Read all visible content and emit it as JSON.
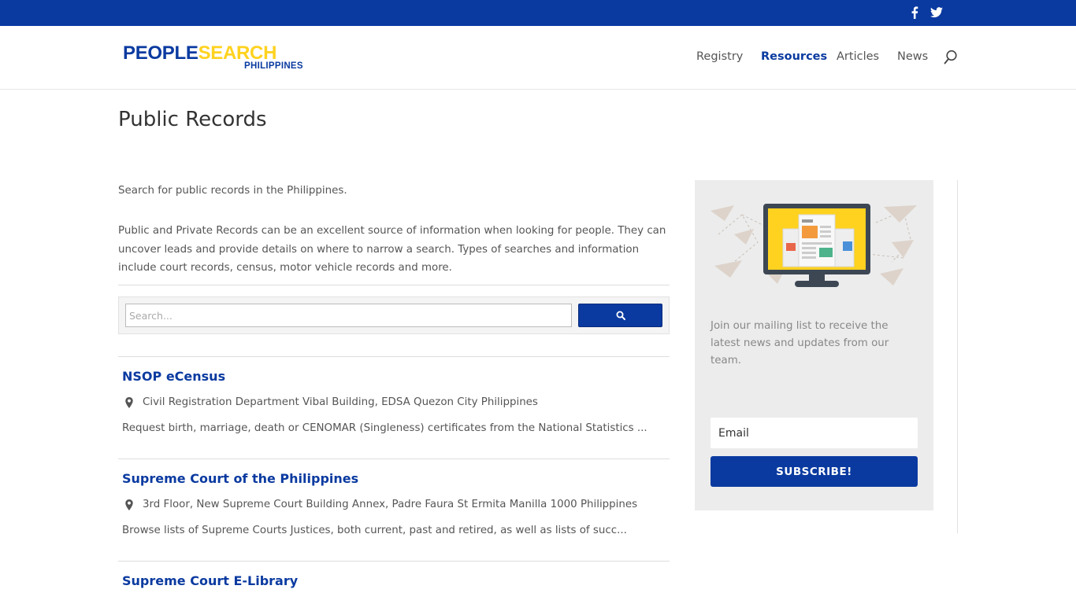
{
  "topbar": {
    "social": [
      {
        "name": "facebook-icon"
      },
      {
        "name": "twitter-icon"
      }
    ]
  },
  "header": {
    "logo": {
      "part1": "PEOPLE",
      "part2": "SEARCH",
      "sub": "PHILIPPINES"
    },
    "nav": [
      {
        "label": "Registry",
        "active": false
      },
      {
        "label": "Resources",
        "active": true
      },
      {
        "label": "Articles",
        "active": false
      },
      {
        "label": "News",
        "active": false
      }
    ]
  },
  "page": {
    "title": "Public Records",
    "intro": "Search for public records in the Philippines.",
    "intro2": "Public and Private Records can be an excellent source of information when looking for people. They can uncover leads and provide details on where to narrow a search. Types of searches and information include court records, census, motor vehicle records and more."
  },
  "search": {
    "placeholder": "Search...",
    "value": ""
  },
  "listings": [
    {
      "title": "NSOP eCensus",
      "address": "Civil Registration Department Vibal Building, EDSA Quezon City Philippines",
      "description": "Request birth, marriage, death or CENOMAR (Singleness) certificates from the National Statistics ..."
    },
    {
      "title": "Supreme Court of the Philippines",
      "address": "3rd Floor, New Supreme Court Building Annex, Padre Faura St Ermita Manilla 1000 Philippines",
      "description": "Browse lists of Supreme Courts Justices, both current, past and retired, as well as lists of succ..."
    },
    {
      "title": "Supreme Court E-Library",
      "address": "",
      "description": ""
    }
  ],
  "sidebar": {
    "text": "Join our mailing list to receive the latest news and updates from our team.",
    "email_placeholder": "Email",
    "subscribe_label": "SUBSCRIBE!"
  },
  "colors": {
    "brand_blue": "#0a3aa0",
    "brand_yellow": "#ffd21f"
  }
}
